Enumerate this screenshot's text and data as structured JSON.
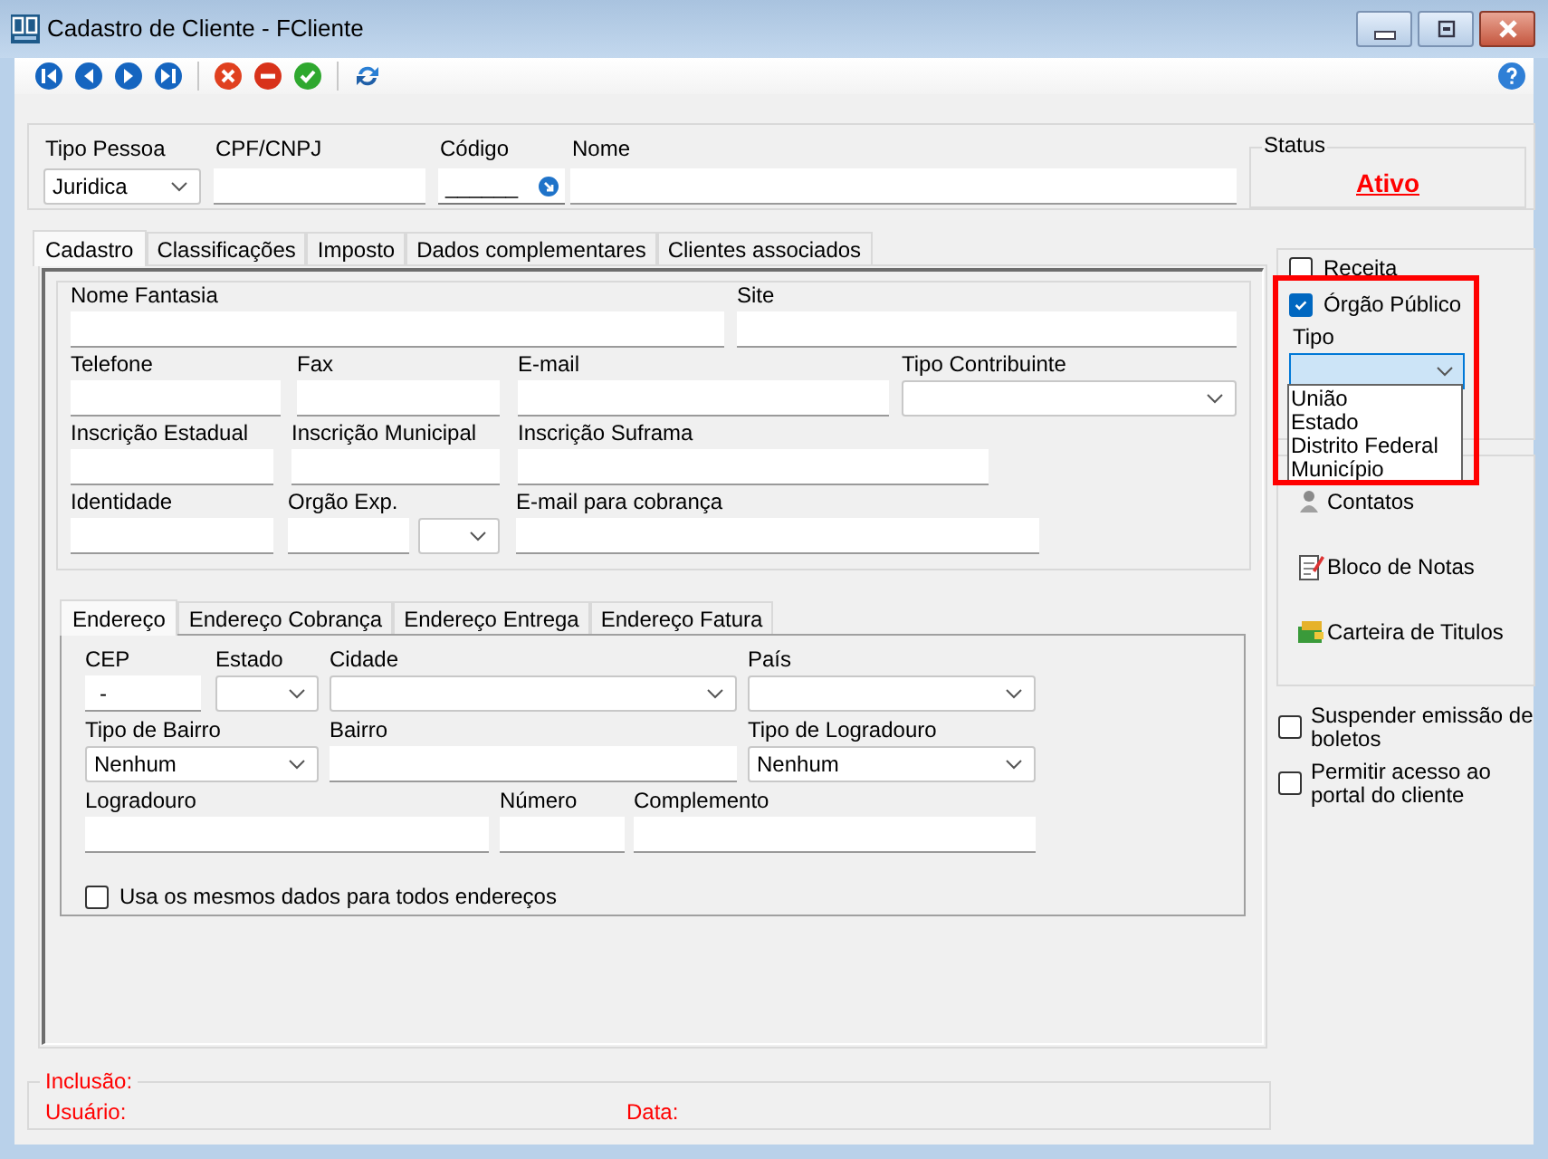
{
  "window": {
    "title": "Cadastro de Cliente - FCliente"
  },
  "header": {
    "fields": [
      {
        "label": "Tipo Pessoa",
        "kind": "combo",
        "value": "Juridica"
      },
      {
        "label": "CPF/CNPJ",
        "kind": "text"
      },
      {
        "label": "Código",
        "kind": "lookup",
        "value": "______"
      },
      {
        "label": "Nome",
        "kind": "text"
      }
    ],
    "status": {
      "label": "Status",
      "value": "Ativo"
    }
  },
  "tabs": [
    {
      "label": "Cadastro",
      "selected": true
    },
    {
      "label": "Classificações",
      "selected": false
    },
    {
      "label": "Imposto",
      "selected": false
    },
    {
      "label": "Dados complementares",
      "selected": false
    },
    {
      "label": "Clientes associados",
      "selected": false
    }
  ],
  "general": {
    "rows": [
      [
        {
          "label": "Nome Fantasia",
          "kind": "text"
        },
        {
          "label": "Site",
          "kind": "text"
        }
      ],
      [
        {
          "label": "Telefone",
          "kind": "text"
        },
        {
          "label": "Fax",
          "kind": "text"
        },
        {
          "label": "E-mail",
          "kind": "text"
        },
        {
          "label": "Tipo Contribuinte",
          "kind": "combo"
        }
      ],
      [
        {
          "label": "Inscrição Estadual",
          "kind": "text"
        },
        {
          "label": "Inscrição Municipal",
          "kind": "text"
        },
        {
          "label": "Inscrição Suframa",
          "kind": "text"
        }
      ],
      [
        {
          "label": "Identidade",
          "kind": "text"
        },
        {
          "label": "Orgão Exp.",
          "kind": "text_combo"
        },
        {
          "label": "E-mail para cobrança",
          "kind": "text"
        }
      ]
    ]
  },
  "address_tabs": [
    {
      "label": "Endereço",
      "selected": true
    },
    {
      "label": "Endereço Cobrança",
      "selected": false
    },
    {
      "label": "Endereço Entrega",
      "selected": false
    },
    {
      "label": "Endereço Fatura",
      "selected": false
    }
  ],
  "address": {
    "rows": [
      [
        {
          "label": "CEP",
          "kind": "text",
          "value": "-"
        },
        {
          "label": "Estado",
          "kind": "combo"
        },
        {
          "label": "Cidade",
          "kind": "combo"
        },
        {
          "label": "País",
          "kind": "combo"
        }
      ],
      [
        {
          "label": "Tipo de Bairro",
          "kind": "combo",
          "value": "Nenhum"
        },
        {
          "label": "Bairro",
          "kind": "text"
        },
        {
          "label": "Tipo de Logradouro",
          "kind": "combo",
          "value": "Nenhum"
        }
      ],
      [
        {
          "label": "Logradouro",
          "kind": "text"
        },
        {
          "label": "Número",
          "kind": "text"
        },
        {
          "label": "Complemento",
          "kind": "text"
        }
      ]
    ],
    "same_data": {
      "label": "Usa os mesmos dados para todos endereços",
      "checked": false
    }
  },
  "inclusion": {
    "title": "Inclusão:",
    "user_label": "Usuário:",
    "date_label": "Data:"
  },
  "side": {
    "receita": {
      "label": "Receita",
      "checked": false
    },
    "orgao_publico": {
      "label": "Órgão Público",
      "checked": true
    },
    "tipo": {
      "label": "Tipo",
      "open": true,
      "options": [
        "União",
        "Estado",
        "Distrito Federal",
        "Município"
      ]
    },
    "links": [
      {
        "label": "Contatos",
        "kind": "contacts"
      },
      {
        "label": "Bloco de Notas",
        "kind": "notes"
      },
      {
        "label": "Carteira de Titulos",
        "kind": "wallet"
      }
    ],
    "checkboxes": [
      {
        "label": "Suspender emissão de boletos",
        "checked": false
      },
      {
        "label": "Permitir acesso ao portal do cliente",
        "checked": false
      }
    ]
  }
}
